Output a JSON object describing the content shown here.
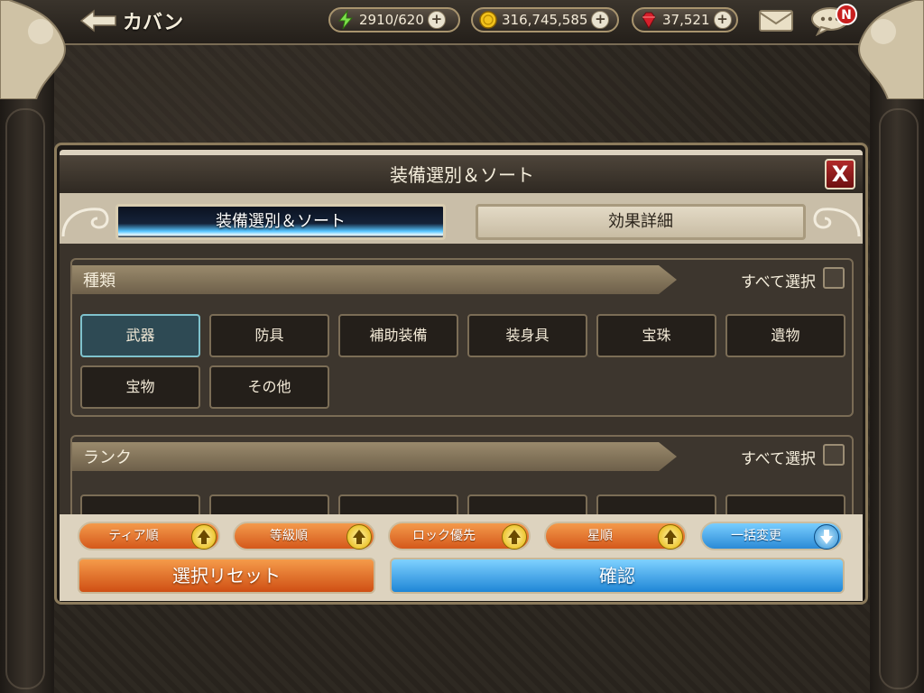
{
  "header": {
    "back_label": "カバン",
    "stamina": "2910/620",
    "gold": "316,745,585",
    "gems": "37,521",
    "notification_badge": "N"
  },
  "dialog": {
    "title": "装備選別＆ソート",
    "close_label": "X",
    "tabs": [
      {
        "label": "装備選別＆ソート",
        "active": true
      },
      {
        "label": "効果詳細",
        "active": false
      }
    ],
    "sections": [
      {
        "label": "種類",
        "select_all_label": "すべて選択",
        "categories": [
          {
            "label": "武器",
            "selected": true
          },
          {
            "label": "防具",
            "selected": false
          },
          {
            "label": "補助装備",
            "selected": false
          },
          {
            "label": "装身具",
            "selected": false
          },
          {
            "label": "宝珠",
            "selected": false
          },
          {
            "label": "遺物",
            "selected": false
          },
          {
            "label": "宝物",
            "selected": false
          },
          {
            "label": "その他",
            "selected": false
          }
        ]
      },
      {
        "label": "ランク",
        "select_all_label": "すべて選択"
      }
    ],
    "sort_buttons": [
      {
        "label": "ティア順",
        "direction": "up"
      },
      {
        "label": "等級順",
        "direction": "up"
      },
      {
        "label": "ロック優先",
        "direction": "up"
      },
      {
        "label": "星順",
        "direction": "up"
      },
      {
        "label": "一括変更",
        "direction": "down"
      }
    ],
    "reset_label": "選択リセット",
    "confirm_label": "確認"
  },
  "colors": {
    "orange_button": "#e0702c",
    "blue_button": "#3b9ee6",
    "selected_category": "#2e4a54"
  }
}
